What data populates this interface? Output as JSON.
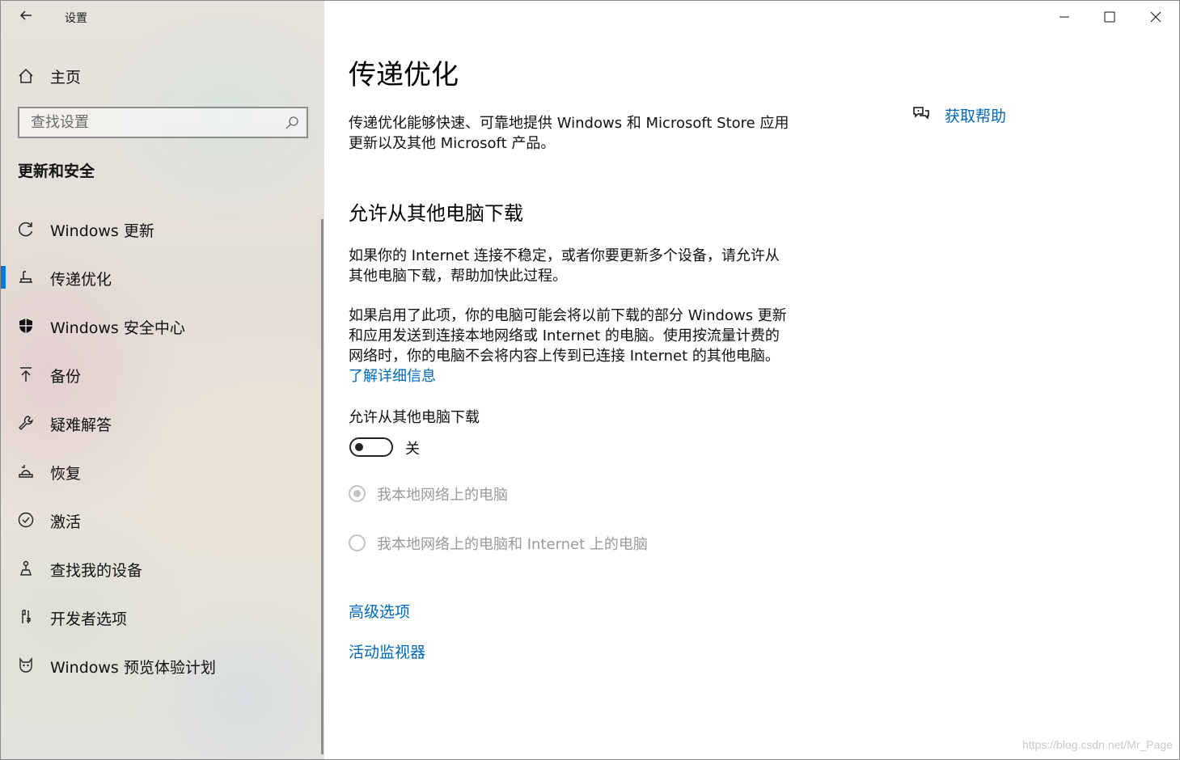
{
  "window": {
    "app_title": "设置",
    "controls": {
      "minimize": "minimize-icon",
      "maximize": "maximize-icon",
      "close": "close-icon"
    }
  },
  "sidebar": {
    "home_label": "主页",
    "search_placeholder": "查找设置",
    "section_heading": "更新和安全",
    "items": [
      {
        "label": "Windows 更新",
        "icon": "refresh-icon",
        "selected": false
      },
      {
        "label": "传递优化",
        "icon": "delivery-optimization-icon",
        "selected": true
      },
      {
        "label": "Windows 安全中心",
        "icon": "shield-icon",
        "selected": false
      },
      {
        "label": "备份",
        "icon": "backup-arrow-icon",
        "selected": false
      },
      {
        "label": "疑难解答",
        "icon": "wrench-icon",
        "selected": false
      },
      {
        "label": "恢复",
        "icon": "recovery-icon",
        "selected": false
      },
      {
        "label": "激活",
        "icon": "check-circle-icon",
        "selected": false
      },
      {
        "label": "查找我的设备",
        "icon": "find-device-icon",
        "selected": false
      },
      {
        "label": "开发者选项",
        "icon": "developer-tools-icon",
        "selected": false
      },
      {
        "label": "Windows 预览体验计划",
        "icon": "insider-cat-icon",
        "selected": false
      }
    ]
  },
  "content": {
    "title": "传递优化",
    "intro_line1": "传递优化能够快速、可靠地提供 Windows 和 Microsoft Store 应用",
    "intro_line2": "更新以及其他 Microsoft 产品。",
    "section_title": "允许从其他电脑下载",
    "para1_line1": "如果你的 Internet 连接不稳定，或者你要更新多个设备，请允许从",
    "para1_line2": "其他电脑下载，帮助加快此过程。",
    "para2_line1": "如果启用了此项，你的电脑可能会将以前下载的部分 Windows 更新",
    "para2_line2": "和应用发送到连接本地网络或 Internet 的电脑。使用按流量计费的",
    "para2_line3": "网络时，你的电脑不会将内容上传到已连接 Internet 的其他电脑。",
    "learn_more": "了解详细信息",
    "toggle_label": "允许从其他电脑下载",
    "toggle_state": "关",
    "radio_options": [
      {
        "label": "我本地网络上的电脑",
        "selected": true,
        "disabled": true
      },
      {
        "label": "我本地网络上的电脑和 Internet 上的电脑",
        "selected": false,
        "disabled": true
      }
    ],
    "advanced_options": "高级选项",
    "activity_monitor": "活动监视器",
    "help_link": "获取帮助"
  },
  "watermark": "https://blog.csdn.net/Mr_Page",
  "colors": {
    "accent": "#0067b8",
    "selection_bar": "#0078d7",
    "disabled": "#9a9a9a"
  }
}
